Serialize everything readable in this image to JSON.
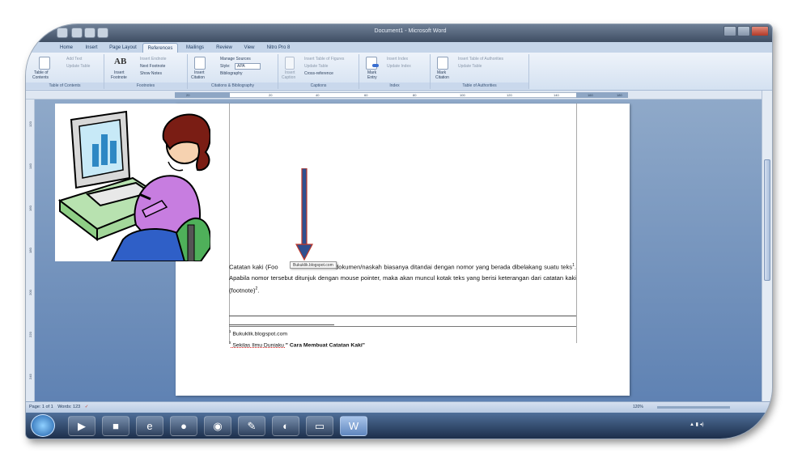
{
  "window": {
    "title": "Document1 - Microsoft Word"
  },
  "tabs": [
    "Home",
    "Insert",
    "Page Layout",
    "References",
    "Mailings",
    "Review",
    "View",
    "Nitro Pro 8"
  ],
  "ribbon": {
    "toc": {
      "add_text": "Add Text",
      "update_table": "Update Table",
      "table_of_contents_1": "Table of",
      "table_of_contents_2": "Contents",
      "group": "Table of Contents"
    },
    "footnotes": {
      "insert_endnote": "Insert Endnote",
      "next_footnote": "Next Footnote",
      "show_notes": "Show Notes",
      "insert_footnote_1": "Insert",
      "insert_footnote_2": "Footnote",
      "group": "Footnotes"
    },
    "citations": {
      "manage_sources": "Manage Sources",
      "style_label": "Style:",
      "style_value": "APA",
      "bibliography": "Bibliography",
      "insert_citation_1": "Insert",
      "insert_citation_2": "Citation",
      "group": "Citations & Bibliography"
    },
    "captions": {
      "insert_table_of_figures": "Insert Table of Figures",
      "update_table": "Update Table",
      "cross_reference": "Cross-reference",
      "insert_caption_1": "Insert",
      "insert_caption_2": "Caption",
      "group": "Captions"
    },
    "index": {
      "insert_index": "Insert Index",
      "update_index": "Update Index",
      "mark_entry_1": "Mark",
      "mark_entry_2": "Entry",
      "group": "Index"
    },
    "authorities": {
      "insert_table_of_authorities": "Insert Table of Authorities",
      "update_table": "Update Table",
      "mark_citation_1": "Mark",
      "mark_citation_2": "Citation",
      "group": "Table of Authorities"
    }
  },
  "ruler": {
    "ticks": [
      "20",
      "20",
      "40",
      "60",
      "80",
      "100",
      "120",
      "140",
      "160",
      "180"
    ]
  },
  "vruler": {
    "ticks": [
      "120",
      "140",
      "160",
      "180",
      "200",
      "220",
      "240"
    ]
  },
  "document": {
    "tooltip": "Bukuklik.blogspot.com",
    "para_part1": "Catatan kaki (Foo",
    "para_part2": " dokumen/naskah biasanya ditandai dengan nomor yang berada dibelakang suatu teks",
    "sup1": "1",
    "para_part3": ". Apabila nomor tersebut ditunjuk dengan mouse pointer, maka akan muncul kotak teks yang berisi keterangan dari catatan kaki (footnote)",
    "sup2": "2",
    "para_end": ".",
    "footnote1_num": "1",
    "footnote1_text": " Bukuklik.blogspot.com",
    "footnote2_num": "2",
    "footnote2_text_a": " Sekilas Ilmu Duniaku ",
    "footnote2_text_b": "\" Cara Membuat Catatan Kaki\""
  },
  "statusbar": {
    "page": "Page: 1 of 1",
    "words": "Words: 123",
    "zoom": "120%"
  },
  "colors": {
    "ribbon_tab_text": "#1e3a5f",
    "arrow_fill": "#2f4f8f",
    "arrow_outline": "#c0392b"
  }
}
